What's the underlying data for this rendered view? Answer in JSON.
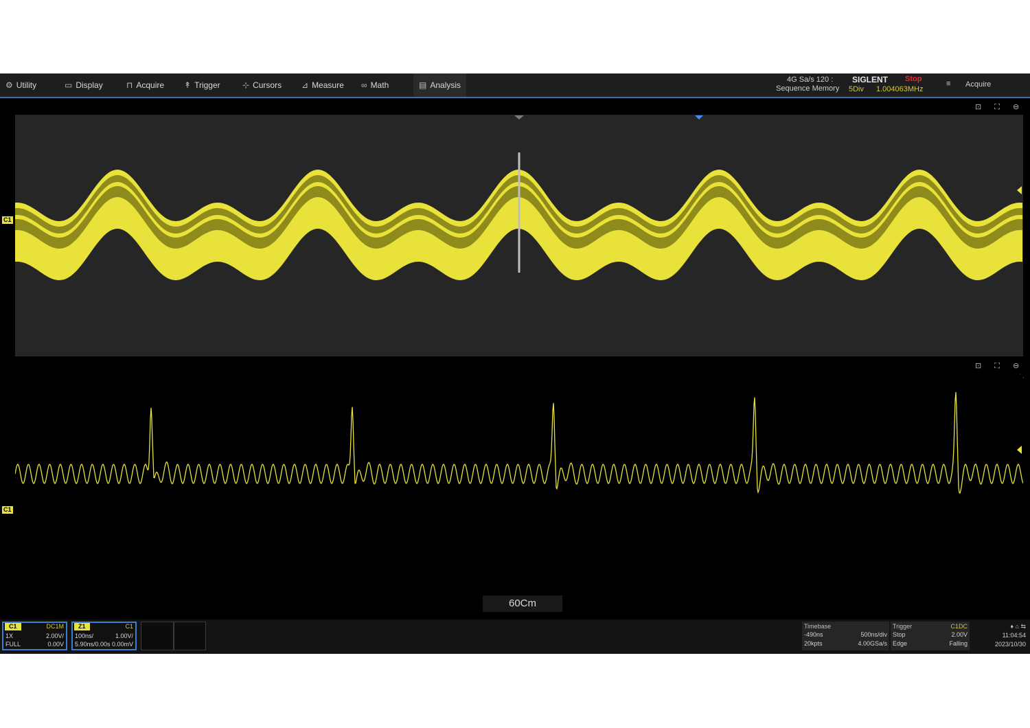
{
  "menu": {
    "items": [
      {
        "label": "Utility",
        "icon": "gear-icon",
        "glyph": "⚙"
      },
      {
        "label": "Display",
        "icon": "monitor-icon",
        "glyph": "▭"
      },
      {
        "label": "Acquire",
        "icon": "acquire-icon",
        "glyph": "⊓"
      },
      {
        "label": "Trigger",
        "icon": "trigger-icon",
        "glyph": "↟"
      },
      {
        "label": "Cursors",
        "icon": "cursors-icon",
        "glyph": "⊹"
      },
      {
        "label": "Measure",
        "icon": "measure-icon",
        "glyph": "⊿"
      },
      {
        "label": "Math",
        "icon": "math-icon",
        "glyph": "∞"
      },
      {
        "label": "Analysis",
        "icon": "analysis-icon",
        "glyph": "▤"
      }
    ]
  },
  "status": {
    "acq_line1": "4G Sa/s 120 :",
    "acq_line2": "Sequence Memory",
    "brand": "SIGLENT",
    "run_state": "Stop",
    "ch_indicator": "5Div",
    "frequency": "1.004063MHz",
    "mode_label": "Acquire"
  },
  "windows": {
    "main": {
      "channel_label": "C1",
      "controls": "⊡ ⛶ ⊖"
    },
    "zoom": {
      "channel_label": "C1",
      "controls": "⊡ ⛶ ⊖",
      "zoom_label": "60Cm"
    }
  },
  "channels": [
    {
      "tag": "C1",
      "coupling": "DC1M",
      "r1a": "1X",
      "r1b": "2.00V/",
      "r2a": "FULL",
      "r2b": "0.00V"
    },
    {
      "tag": "Z1",
      "coupling": "C1",
      "r1a": "100ns/",
      "r1b": "1.00V/",
      "r2a": "5.90ns/0.00s",
      "r2b": "0.00mV"
    }
  ],
  "timebase": {
    "title": "Timebase",
    "delay": "-490ns",
    "scale": "500ns/div",
    "memory": "20kpts",
    "rate": "4.00GSa/s"
  },
  "trigger": {
    "title": "Trigger",
    "coupling": "C1DC",
    "mode": "Stop",
    "level": "2.00V",
    "type": "Edge",
    "slope": "Falling"
  },
  "clock": {
    "time": "11:04:54",
    "date": "2023/10/30",
    "icons": "♦ ⌂ ⇆"
  },
  "colors": {
    "trace": "#e8e23a",
    "trace_dark": "#8e8a1c",
    "accent": "#3a6fb0"
  }
}
